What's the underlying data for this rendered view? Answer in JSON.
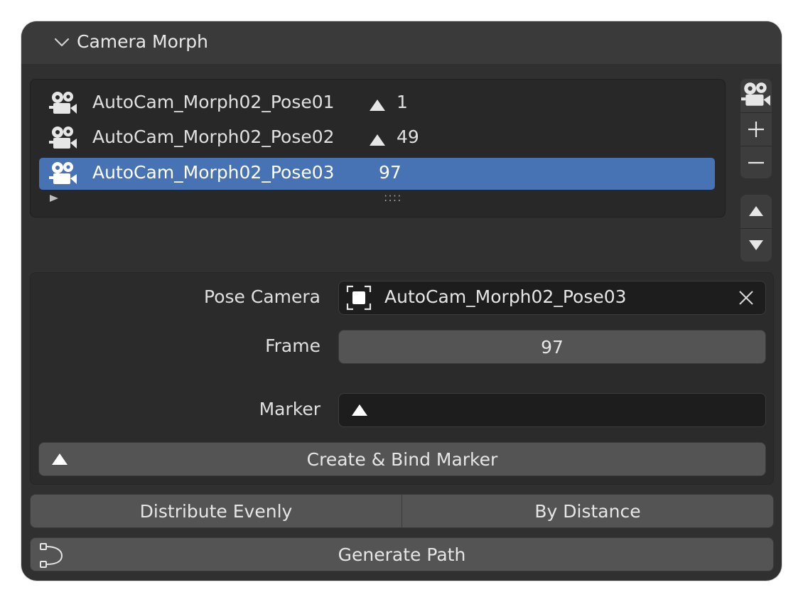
{
  "panel": {
    "title": "Camera Morph"
  },
  "poses": [
    {
      "name": "AutoCam_Morph02_Pose01",
      "frame": "1",
      "has_marker": true,
      "selected": false
    },
    {
      "name": "AutoCam_Morph02_Pose02",
      "frame": "49",
      "has_marker": true,
      "selected": false
    },
    {
      "name": "AutoCam_Morph02_Pose03",
      "frame": "97",
      "has_marker": false,
      "selected": true
    }
  ],
  "list": {
    "grip": "::::"
  },
  "side_buttons": {
    "camera_icon": "camera-icon",
    "add_icon": "plus-icon",
    "remove_icon": "minus-icon",
    "up_icon": "arrow-up-icon",
    "down_icon": "arrow-down-icon"
  },
  "properties": {
    "pose_camera_label": "Pose Camera",
    "pose_camera_value": "AutoCam_Morph02_Pose03",
    "frame_label": "Frame",
    "frame_value": "97",
    "marker_label": "Marker",
    "marker_value": ""
  },
  "buttons": {
    "create_bind_marker": "Create & Bind Marker",
    "distribute_evenly": "Distribute Evenly",
    "by_distance": "By Distance",
    "generate_path": "Generate Path"
  },
  "colors": {
    "panel_bg": "#303030",
    "header_bg": "#3a3a3a",
    "selection": "#4772b3",
    "button": "#545454",
    "field_dark": "#1d1d1d"
  }
}
